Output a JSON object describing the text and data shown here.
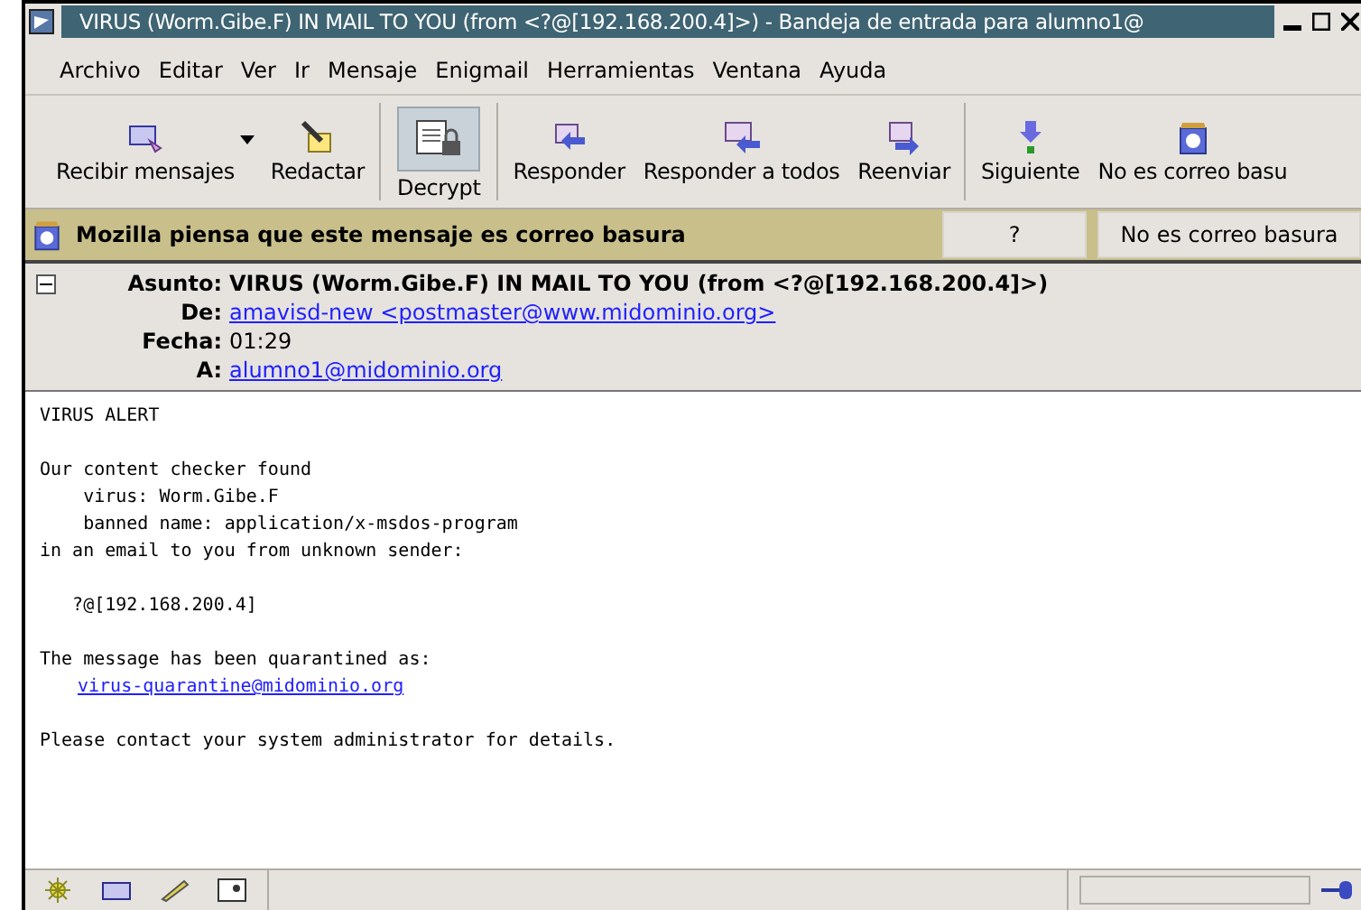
{
  "window": {
    "title": "VIRUS (Worm.Gibe.F) IN MAIL TO YOU (from <?@[192.168.200.4]>) - Bandeja de entrada para alumno1@"
  },
  "menu": [
    "Archivo",
    "Editar",
    "Ver",
    "Ir",
    "Mensaje",
    "Enigmail",
    "Herramientas",
    "Ventana",
    "Ayuda"
  ],
  "toolbar": [
    [
      {
        "label": "Recibir mensajes",
        "kind": "get",
        "dropdown": true,
        "pressed": false
      },
      {
        "label": "Redactar",
        "kind": "write",
        "dropdown": false,
        "pressed": false
      }
    ],
    [
      {
        "label": "Decrypt",
        "kind": "decrypt",
        "dropdown": false,
        "pressed": true
      }
    ],
    [
      {
        "label": "Responder",
        "kind": "reply",
        "dropdown": false,
        "pressed": false
      },
      {
        "label": "Responder a todos",
        "kind": "replyall",
        "dropdown": false,
        "pressed": false
      },
      {
        "label": "Reenviar",
        "kind": "forward",
        "dropdown": false,
        "pressed": false
      }
    ],
    [
      {
        "label": "Siguiente",
        "kind": "next",
        "dropdown": false,
        "pressed": false
      },
      {
        "label": "No es correo basu",
        "kind": "junk",
        "dropdown": false,
        "pressed": false
      }
    ]
  ],
  "junk_bar": {
    "message": "Mozilla piensa que este mensaje es correo basura",
    "help_button": "?",
    "not_junk_button": "No es correo basura"
  },
  "headers": {
    "expanded": true,
    "fields": [
      {
        "label": "Asunto:",
        "value": "VIRUS (Worm.Gibe.F) IN MAIL TO YOU (from <?@[192.168.200.4]>)",
        "kind": "bold"
      },
      {
        "label": "De:",
        "value": "amavisd-new <postmaster@www.midominio.org>",
        "kind": "link"
      },
      {
        "label": "Fecha:",
        "value": "01:29",
        "kind": "plain"
      },
      {
        "label": "A:",
        "value": "alumno1@midominio.org",
        "kind": "link"
      }
    ]
  },
  "body": [
    [
      {
        "text": "VIRUS ALERT",
        "kind": "text"
      }
    ],
    [
      {
        "text": "Our content checker found",
        "kind": "text"
      },
      {
        "text": "    virus: Worm.Gibe.F",
        "kind": "text"
      },
      {
        "text": "    banned name: application/x-msdos-program",
        "kind": "text"
      },
      {
        "text": "in an email to you from unknown sender:",
        "kind": "text"
      }
    ],
    [
      {
        "text": "   ?@[192.168.200.4]",
        "kind": "text"
      }
    ],
    [
      {
        "text": "The message has been quarantined as:",
        "kind": "text"
      },
      {
        "text": "virus-quarantine@midominio.org",
        "kind": "link"
      }
    ],
    [
      {
        "text": "Please contact your system administrator for details.",
        "kind": "text"
      }
    ]
  ],
  "status": {
    "progress": {
      "level": 0
    }
  }
}
